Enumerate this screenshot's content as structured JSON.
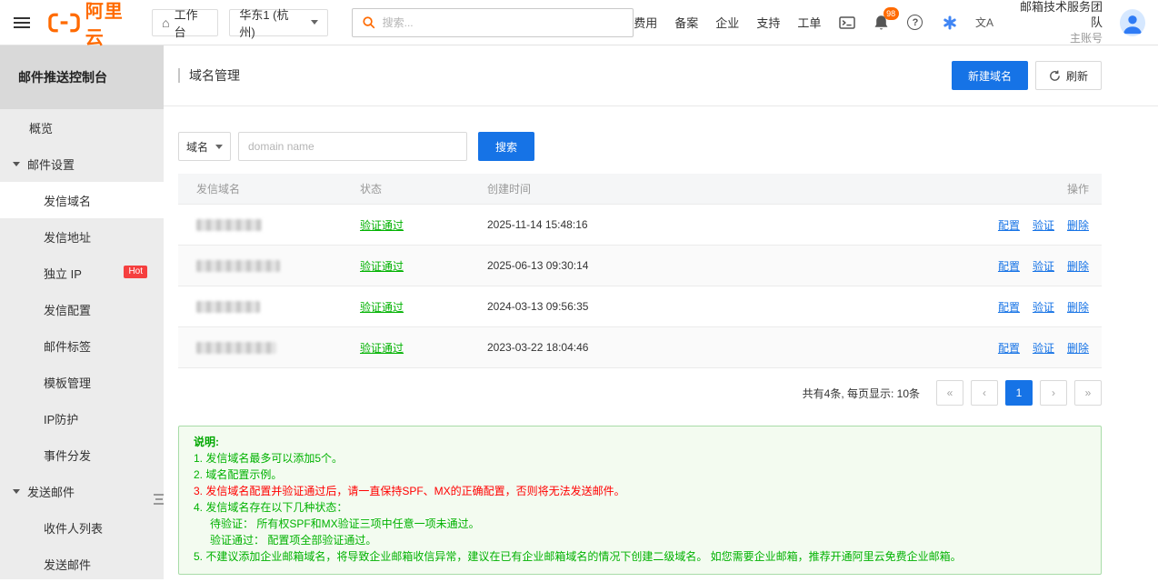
{
  "colors": {
    "accent_blue": "#1673E6",
    "brand_orange": "#FF6A00",
    "status_green": "#00B200",
    "warning_red": "#FF0000",
    "hot_badge_red": "#F53F3F"
  },
  "topbar": {
    "logo_text": "阿里云",
    "workbench_label": "工作台",
    "region": "华东1 (杭州)",
    "search_placeholder": "搜索...",
    "nav_links": [
      "费用",
      "备案",
      "企业",
      "支持",
      "工单"
    ],
    "bell_badge": "98",
    "account": {
      "team": "邮箱技术服务团队",
      "role": "主账号"
    },
    "icons": {
      "home": "⌂",
      "help": "?",
      "language": "文A"
    }
  },
  "sidebar": {
    "title": "邮件推送控制台",
    "items": [
      {
        "label": "概览"
      },
      {
        "label": "邮件设置"
      },
      {
        "label": "发信域名"
      },
      {
        "label": "发信地址"
      },
      {
        "label": "独立 IP",
        "badge": "Hot"
      },
      {
        "label": "发信配置"
      },
      {
        "label": "邮件标签"
      },
      {
        "label": "模板管理"
      },
      {
        "label": "IP防护"
      },
      {
        "label": "事件分发"
      },
      {
        "label": "发送邮件"
      },
      {
        "label": "收件人列表"
      },
      {
        "label": "发送邮件"
      }
    ]
  },
  "main": {
    "page_title": "域名管理",
    "buttons": {
      "new_domain": "新建域名",
      "refresh": "刷新"
    },
    "filter": {
      "field": "域名",
      "input_value": "",
      "input_placeholder": "domain name",
      "search_button": "搜索"
    },
    "table": {
      "headers": [
        "发信域名",
        "状态",
        "创建时间",
        "操作"
      ],
      "rows": [
        {
          "domain_masked": true,
          "status": "验证通过",
          "created": "2025-11-14 15:48:16",
          "actions": [
            "配置",
            "验证",
            "删除"
          ]
        },
        {
          "domain_masked": true,
          "status": "验证通过",
          "created": "2025-06-13 09:30:14",
          "actions": [
            "配置",
            "验证",
            "删除"
          ]
        },
        {
          "domain_masked": true,
          "status": "验证通过",
          "created": "2024-03-13 09:56:35",
          "actions": [
            "配置",
            "验证",
            "删除"
          ]
        },
        {
          "domain_masked": true,
          "status": "验证通过",
          "created": "2023-03-22 18:04:46",
          "actions": [
            "配置",
            "验证",
            "删除"
          ]
        }
      ]
    },
    "pagination": {
      "summary": "共有4条, 每页显示: 10条",
      "buttons": [
        "«",
        "‹",
        "1",
        "›",
        "»"
      ],
      "current_page": "1"
    },
    "note": {
      "title": "说明:",
      "lines": [
        {
          "text": "1. 发信域名最多可以添加5个。"
        },
        {
          "text": "2. 域名配置示例。"
        },
        {
          "text": "3. 发信域名配置并验证通过后，请一直保持SPF、MX的正确配置，否则将无法发送邮件。"
        },
        {
          "text": "4. 发信域名存在以下几种状态："
        },
        {
          "text": "待验证： 所有权SPF和MX验证三项中任意一项未通过。"
        },
        {
          "text": "验证通过： 配置项全部验证通过。"
        },
        {
          "text": "5. 不建议添加企业邮箱域名，将导致企业邮箱收信异常，建议在已有企业邮箱域名的情况下创建二级域名。 如您需要企业邮箱，推荐开通阿里云免费企业邮箱。"
        }
      ]
    }
  }
}
